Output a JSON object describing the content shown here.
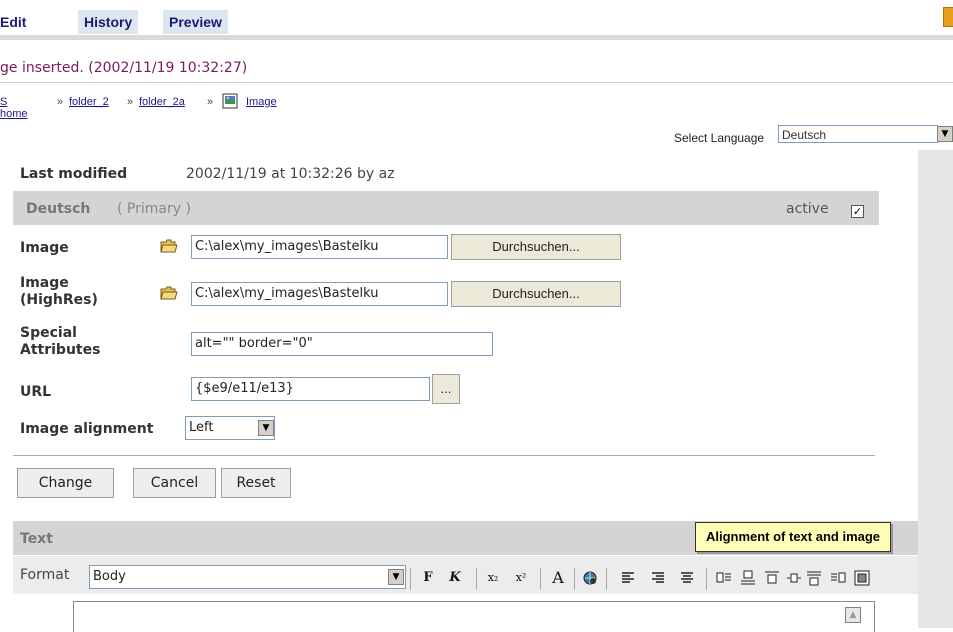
{
  "tabs": {
    "edit": "Edit",
    "history": "History",
    "preview": "Preview"
  },
  "status_message": "ge inserted. (2002/11/19 10:32:27)",
  "breadcrumb": {
    "items": [
      "S home",
      "folder_2",
      "folder_2a",
      "Image"
    ],
    "separator": "»"
  },
  "language": {
    "label": "Select Language",
    "value": "Deutsch"
  },
  "last_modified": {
    "label": "Last modified",
    "value": "2002/11/19 at 10:32:26 by az"
  },
  "section_primary": {
    "language": "Deutsch",
    "primary": "( Primary )",
    "active_label": "active",
    "active_checked": true
  },
  "fields": {
    "image": {
      "label": "Image",
      "value": "C:\\alex\\my_images\\Bastelku",
      "browse": "Durchsuchen..."
    },
    "image_highres": {
      "label": "Image (HighRes)",
      "value": "C:\\alex\\my_images\\Bastelku",
      "browse": "Durchsuchen..."
    },
    "special_attributes": {
      "label": "Special Attributes",
      "value": "alt=\"\" border=\"0\""
    },
    "url": {
      "label": "URL",
      "value": "{$e9/e11/e13}",
      "picker": "..."
    },
    "image_alignment": {
      "label": "Image alignment",
      "value": "Left"
    }
  },
  "buttons": {
    "change": "Change",
    "cancel": "Cancel",
    "reset": "Reset"
  },
  "text_section": {
    "label": "Text",
    "format_label": "Format",
    "format_value": "Body"
  },
  "tooltip": "Alignment of text and image",
  "toolbar": {
    "bold": "F",
    "italic": "K",
    "subscript": "x₂",
    "superscript": "x²",
    "font": "A"
  },
  "colors": {
    "tab_text": "#1a1a7a",
    "status": "#7a1a5a",
    "section_bg": "#d4d4d4",
    "tooltip_bg": "#ffffb8"
  }
}
